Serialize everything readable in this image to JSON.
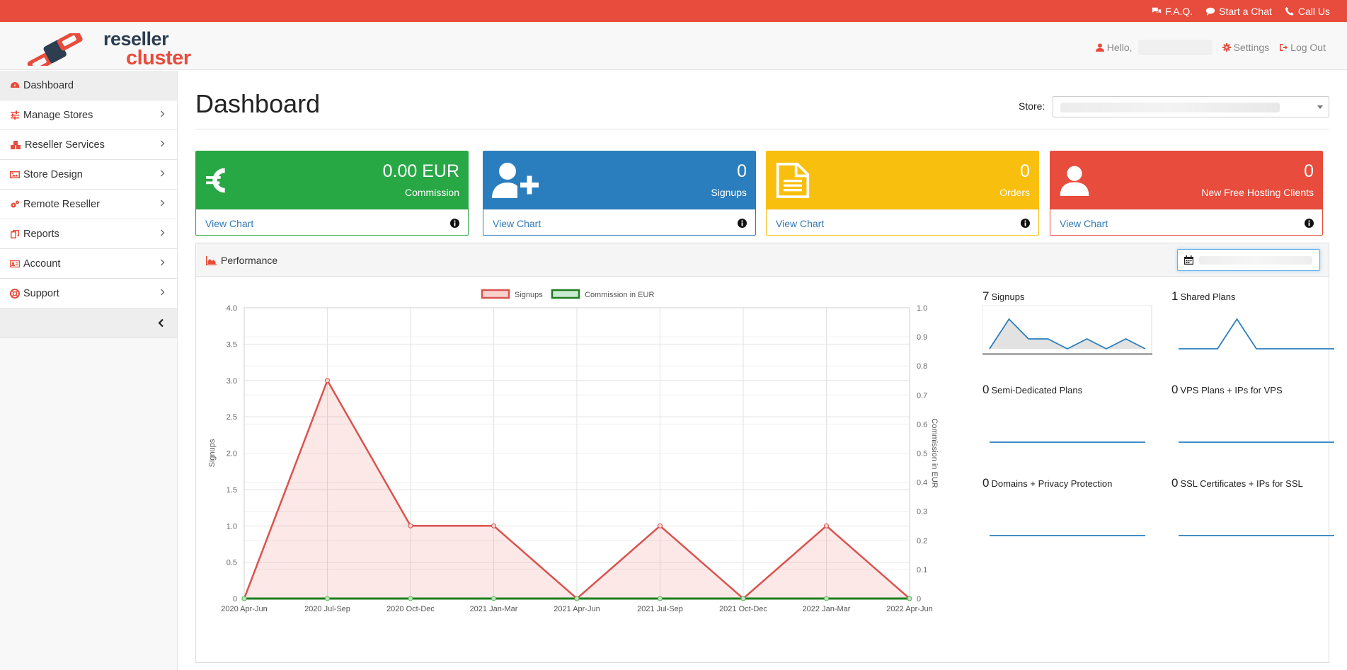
{
  "topbar": {
    "faq": "F.A.Q.",
    "chat": "Start a Chat",
    "call": "Call Us"
  },
  "logo": {
    "line1": "reseller",
    "line2": "cluster"
  },
  "header": {
    "hello": "Hello,",
    "settings": "Settings",
    "logout": "Log Out"
  },
  "sidebar": {
    "items": [
      {
        "label": "Dashboard",
        "icon": "dashboard-icon"
      },
      {
        "label": "Manage Stores",
        "icon": "sliders-icon"
      },
      {
        "label": "Reseller Services",
        "icon": "cubes-icon"
      },
      {
        "label": "Store Design",
        "icon": "image-icon"
      },
      {
        "label": "Remote Reseller",
        "icon": "cogs-icon"
      },
      {
        "label": "Reports",
        "icon": "reports-icon"
      },
      {
        "label": "Account",
        "icon": "id-card-icon"
      },
      {
        "label": "Support",
        "icon": "life-ring-icon"
      }
    ]
  },
  "page": {
    "title": "Dashboard",
    "store_label": "Store:"
  },
  "cards": [
    {
      "value": "0.00 EUR",
      "label": "Commission",
      "link": "View Chart",
      "color": "#28a745",
      "icon": "euro-icon"
    },
    {
      "value": "0",
      "label": "Signups",
      "link": "View Chart",
      "color": "#2a7ebd",
      "icon": "user-plus-icon"
    },
    {
      "value": "0",
      "label": "Orders",
      "link": "View Chart",
      "color": "#f9bf0f",
      "icon": "file-icon"
    },
    {
      "value": "0",
      "label": "New Free Hosting Clients",
      "link": "View Chart",
      "color": "#e74c3c",
      "icon": "user-icon"
    }
  ],
  "performance": {
    "title": "Performance"
  },
  "chart_data": {
    "type": "line",
    "categories": [
      "2020 Apr-Jun",
      "2020 Jul-Sep",
      "2020 Oct-Dec",
      "2021 Jan-Mar",
      "2021 Apr-Jun",
      "2021 Jul-Sep",
      "2021 Oct-Dec",
      "2022 Jan-Mar",
      "2022 Apr-Jun"
    ],
    "series": [
      {
        "name": "Signups",
        "values": [
          0,
          3,
          1,
          1,
          0,
          1,
          0,
          1,
          0
        ],
        "axis": "left",
        "color": "#d9534f",
        "fill": "rgba(231,76,60,0.13)"
      },
      {
        "name": "Commission in EUR",
        "values": [
          0,
          0,
          0,
          0,
          0,
          0,
          0,
          0,
          0
        ],
        "axis": "right",
        "color": "#1e7d1e",
        "fill": "rgba(40,167,69,0.15)"
      }
    ],
    "ylabel": "Signups",
    "y2label": "Commission in EUR",
    "ylim": [
      0,
      4
    ],
    "y2lim": [
      0,
      1
    ],
    "yticks": [
      "0",
      "0.5",
      "1.0",
      "1.5",
      "2.0",
      "2.5",
      "3.0",
      "3.5",
      "4.0"
    ],
    "y2ticks": [
      "0",
      "0.1",
      "0.2",
      "0.3",
      "0.4",
      "0.5",
      "0.6",
      "0.7",
      "0.8",
      "0.9",
      "1.0"
    ],
    "legend": "top",
    "grid": true
  },
  "sparklines": [
    {
      "count": "7",
      "label": "Signups",
      "values": [
        0,
        3,
        1,
        1,
        0,
        1,
        0,
        1,
        0
      ],
      "filled": true
    },
    {
      "count": "1",
      "label": "Shared Plans",
      "values": [
        0,
        0,
        0,
        1,
        0,
        0,
        0,
        0,
        0
      ],
      "filled": false
    },
    {
      "count": "0",
      "label": "Semi-Dedicated Plans",
      "values": [
        0,
        0,
        0,
        0,
        0,
        0,
        0,
        0,
        0
      ],
      "filled": false
    },
    {
      "count": "0",
      "label": "VPS Plans + IPs for VPS",
      "values": [
        0,
        0,
        0,
        0,
        0,
        0,
        0,
        0,
        0
      ],
      "filled": false
    },
    {
      "count": "0",
      "label": "Domains + Privacy Protection",
      "values": [
        0,
        0,
        0,
        0,
        0,
        0,
        0,
        0,
        0
      ],
      "filled": false
    },
    {
      "count": "0",
      "label": "SSL Certificates + IPs for SSL",
      "values": [
        0,
        0,
        0,
        0,
        0,
        0,
        0,
        0,
        0
      ],
      "filled": false
    }
  ]
}
